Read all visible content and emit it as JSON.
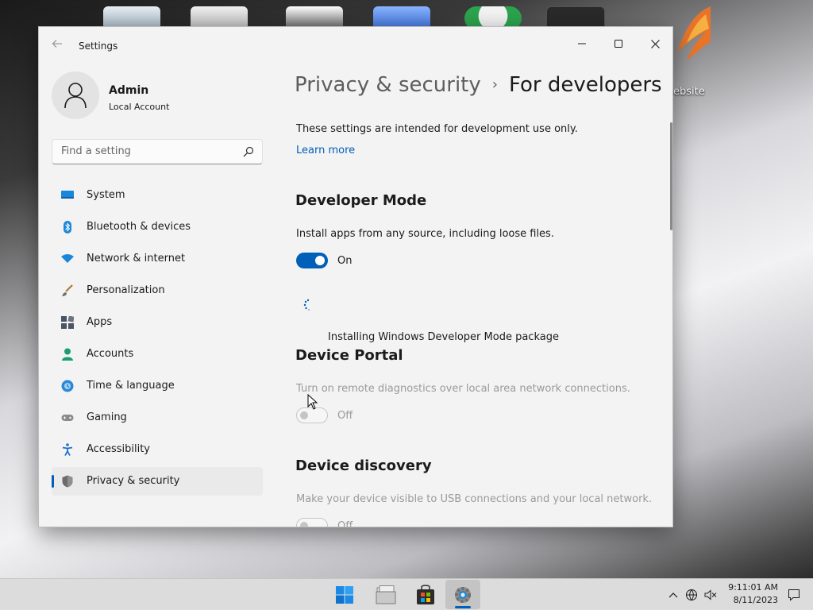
{
  "desktop": {
    "icon_label": "ebsite"
  },
  "window": {
    "app_title": "Settings",
    "controls": {
      "minimize": "minimize",
      "maximize": "maximize",
      "close": "close"
    }
  },
  "profile": {
    "name": "Admin",
    "account_type": "Local Account"
  },
  "search": {
    "placeholder": "Find a setting"
  },
  "sidebar": {
    "items": [
      {
        "label": "System",
        "icon": "system-icon",
        "color": "#0078d4"
      },
      {
        "label": "Bluetooth & devices",
        "icon": "bluetooth-icon",
        "color": "#0067c0"
      },
      {
        "label": "Network & internet",
        "icon": "wifi-icon",
        "color": "#0a84d8"
      },
      {
        "label": "Personalization",
        "icon": "brush-icon",
        "color": "#c58b3a"
      },
      {
        "label": "Apps",
        "icon": "apps-icon",
        "color": "#545b66"
      },
      {
        "label": "Accounts",
        "icon": "person-icon",
        "color": "#1a9e6e"
      },
      {
        "label": "Time & language",
        "icon": "globe-clock-icon",
        "color": "#2b88d8"
      },
      {
        "label": "Gaming",
        "icon": "controller-icon",
        "color": "#7a7a7a"
      },
      {
        "label": "Accessibility",
        "icon": "accessibility-icon",
        "color": "#1a6fd0"
      },
      {
        "label": "Privacy & security",
        "icon": "shield-icon",
        "color": "#6b6b6b",
        "active": true
      }
    ]
  },
  "breadcrumb": {
    "parent": "Privacy & security",
    "current": "For developers"
  },
  "content": {
    "intro": "These settings are intended for development use only.",
    "learn_more": "Learn more",
    "developer_mode": {
      "title": "Developer Mode",
      "description": "Install apps from any source, including loose files.",
      "toggle_state": "On",
      "installing_text": "Installing Windows Developer Mode package"
    },
    "device_portal": {
      "title": "Device Portal",
      "description": "Turn on remote diagnostics over local area network connections.",
      "toggle_state": "Off"
    },
    "device_discovery": {
      "title": "Device discovery",
      "description": "Make your device visible to USB connections and your local network.",
      "toggle_state": "Off"
    }
  },
  "taskbar": {
    "apps": [
      "start-icon",
      "file-explorer-icon",
      "store-icon",
      "settings-icon"
    ],
    "active_app": "settings-icon",
    "time": "9:11:01 AM",
    "date": "8/11/2023"
  },
  "colors": {
    "accent": "#005fb8",
    "window_bg": "#f3f3f3",
    "taskbar_bg": "#dcdcdc"
  }
}
